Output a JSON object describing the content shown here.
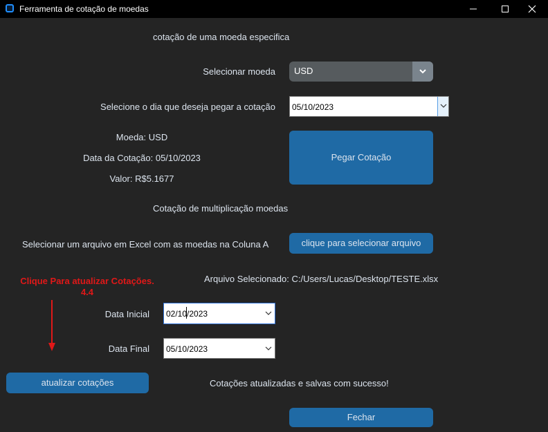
{
  "window": {
    "title": "Ferramenta de cotação de moedas"
  },
  "section_single": {
    "heading": "cotação de uma moeda especifica",
    "currency_label": "Selecionar moeda",
    "currency_value": "USD",
    "date_label": "Selecione o dia que deseja pegar a cotação",
    "date_value": "05/10/2023",
    "result_moeda": "Moeda: USD",
    "result_data": "Data da Cotação: 05/10/2023",
    "result_valor": "Valor: R$5.1677",
    "get_quote_button": "Pegar Cotação"
  },
  "section_multi": {
    "heading": "Cotação de multiplicação moedas",
    "file_prompt": "Selecionar um arquivo em Excel com as moedas na Coluna A",
    "select_file_button": "clique para selecionar arquivo",
    "selected_file": "Arquivo Selecionado: C:/Users/Lucas/Desktop/TESTE.xlsx",
    "start_date_label": "Data Inicial",
    "start_date_value": "02/10/2023",
    "end_date_label": "Data Final",
    "end_date_value": "05/10/2023",
    "update_button": "atualizar cotações",
    "status_message": "Cotações atualizadas e salvas com sucesso!",
    "close_button": "Fechar"
  },
  "annotation": {
    "line1": "Clique Para atualizar Cotações.",
    "line2": "4.4",
    "color": "#e01818"
  },
  "colors": {
    "background": "#242424",
    "button": "#1f6aa5",
    "combo": "#565b5e",
    "combo_arrow": "#7a848d"
  }
}
